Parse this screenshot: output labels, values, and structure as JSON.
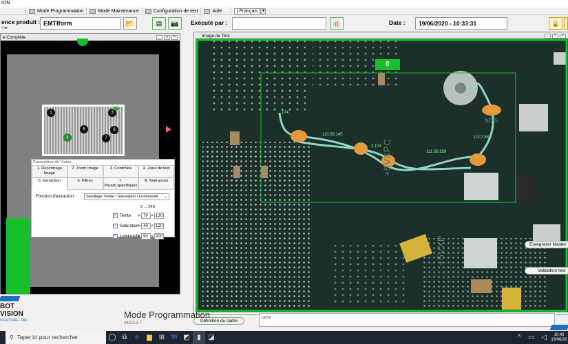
{
  "app": {
    "title_partial": "ION"
  },
  "menubar": {
    "items": [
      "Mode Programmation",
      "Mode Maintenance",
      "Configuration de test",
      "Aide"
    ],
    "language": "Français"
  },
  "toolbar": {
    "ref_label": "ence produit :",
    "ref_value": "EMTIform",
    "ref_sub": "≡◂▸",
    "executed_label": "Exécuté par :",
    "executed_value": "",
    "date_label": "Date :",
    "date_value": "19/06/2020 - 10:33:31"
  },
  "left_window": {
    "title": "e Complète",
    "markers": [
      "1",
      "3",
      "6",
      "8",
      "4",
      "7"
    ]
  },
  "params": {
    "title": "Paramètres de Vision",
    "tabs": [
      "1. Recentrage Image",
      "2. Zoom Image",
      "3. Contrôles",
      "4. Zone de test",
      "5. Extraction",
      "6. Filtres",
      "7. Param.spécifiques",
      "8. Tolérances"
    ],
    "function_label": "Fonction d'extraction",
    "function_value": "Seuillage Teinte / Saturation / Luminosité",
    "range_label": "0 ... 240",
    "rows": [
      {
        "label": "Teinte",
        "min": "70",
        "max": "130"
      },
      {
        "label": "Saturation",
        "min": "40",
        "max": "120"
      },
      {
        "label": "Luminosité",
        "min": "90",
        "max": "200"
      }
    ]
  },
  "right_window": {
    "title": "Image de Test",
    "counter": "0",
    "measurements": [
      "174",
      "110.56.145",
      "2.174",
      "111.56.159",
      "113.2.58",
      "NDIS"
    ],
    "silk": [
      "+5VXPC",
      "+5VXP"
    ],
    "buttons": {
      "save_master": "Enregistrer Master",
      "validate": "Validation test",
      "define_frame": "Définition du cadre"
    },
    "below_label": "cadre"
  },
  "bottom": {
    "mode": "Mode Programmation",
    "version": "V10.0.1.7",
    "logo_top": "BOT",
    "logo_main": "VISION",
    "logo_sub": "IDRATOIRE · RDI"
  },
  "taskbar": {
    "search_placeholder": "Taper ici pour rechercher",
    "time": "10:43",
    "date": "19/06/20"
  },
  "colors": {
    "accent_green": "#17c02a",
    "board": "#1b2f2b",
    "trace": "#8fd6c4",
    "glue": "#e39a3c"
  }
}
